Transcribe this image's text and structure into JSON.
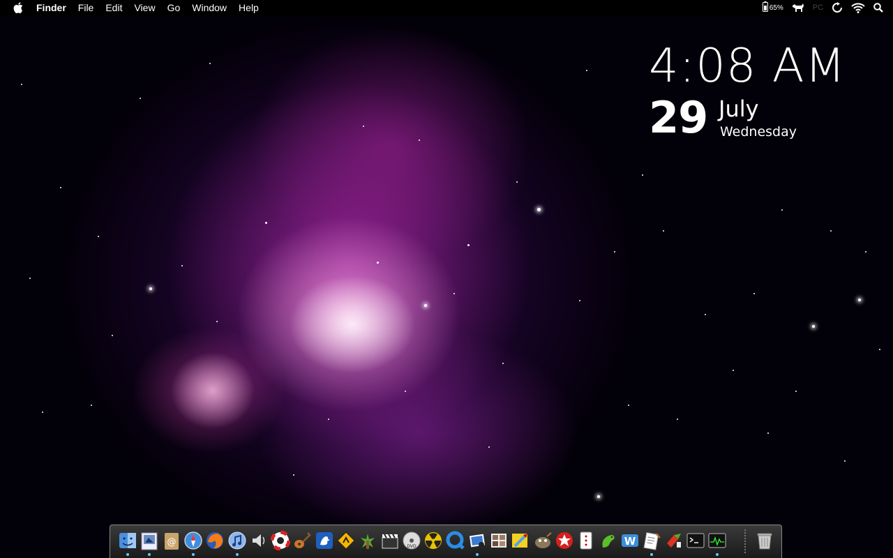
{
  "menubar": {
    "apple_icon": "apple-icon",
    "app_name": "Finder",
    "menus": [
      "File",
      "Edit",
      "View",
      "Go",
      "Window",
      "Help"
    ],
    "status": {
      "battery_percent": "65%",
      "pc_label": "PC",
      "icons": [
        "battery-icon",
        "dog-icon",
        "sync-icon",
        "wifi-icon",
        "spotlight-search-icon"
      ]
    }
  },
  "clock": {
    "time": "4:08 AM",
    "day": "29",
    "month": "July",
    "weekday": "Wednesday"
  },
  "dock": {
    "apps": [
      {
        "icon": "finder-icon",
        "running": true
      },
      {
        "icon": "preview-icon",
        "running": true
      },
      {
        "icon": "address-book-icon",
        "running": false
      },
      {
        "icon": "safari-icon",
        "running": true
      },
      {
        "icon": "firefox-icon",
        "running": false
      },
      {
        "icon": "itunes-icon",
        "running": true
      },
      {
        "icon": "speaker-icon",
        "running": false
      },
      {
        "icon": "lifesaver-icon",
        "running": false
      },
      {
        "icon": "guitar-icon",
        "running": false
      },
      {
        "icon": "cyberduck-icon",
        "running": false
      },
      {
        "icon": "warning-sign-icon",
        "running": false
      },
      {
        "icon": "adium-icon",
        "running": false
      },
      {
        "icon": "clapperboard-icon",
        "running": false
      },
      {
        "icon": "dvd-player-icon",
        "running": false
      },
      {
        "icon": "radiation-icon",
        "running": false
      },
      {
        "icon": "quicktime-icon",
        "running": false
      },
      {
        "icon": "iphoto-icon",
        "running": true
      },
      {
        "icon": "photo-booth-icon",
        "running": false
      },
      {
        "icon": "paintbrush-icon",
        "running": false
      },
      {
        "icon": "gimp-icon",
        "running": false
      },
      {
        "icon": "pokerstars-icon",
        "running": false
      },
      {
        "icon": "playing-card-icon",
        "running": false
      },
      {
        "icon": "gecko-icon",
        "running": false
      },
      {
        "icon": "word-icon",
        "running": false
      },
      {
        "icon": "textedit-icon",
        "running": true
      },
      {
        "icon": "ftp-icon",
        "running": false
      },
      {
        "icon": "terminal-icon",
        "running": false
      },
      {
        "icon": "activity-monitor-icon",
        "running": true
      },
      {
        "icon": "trash-icon",
        "running": false
      }
    ]
  }
}
